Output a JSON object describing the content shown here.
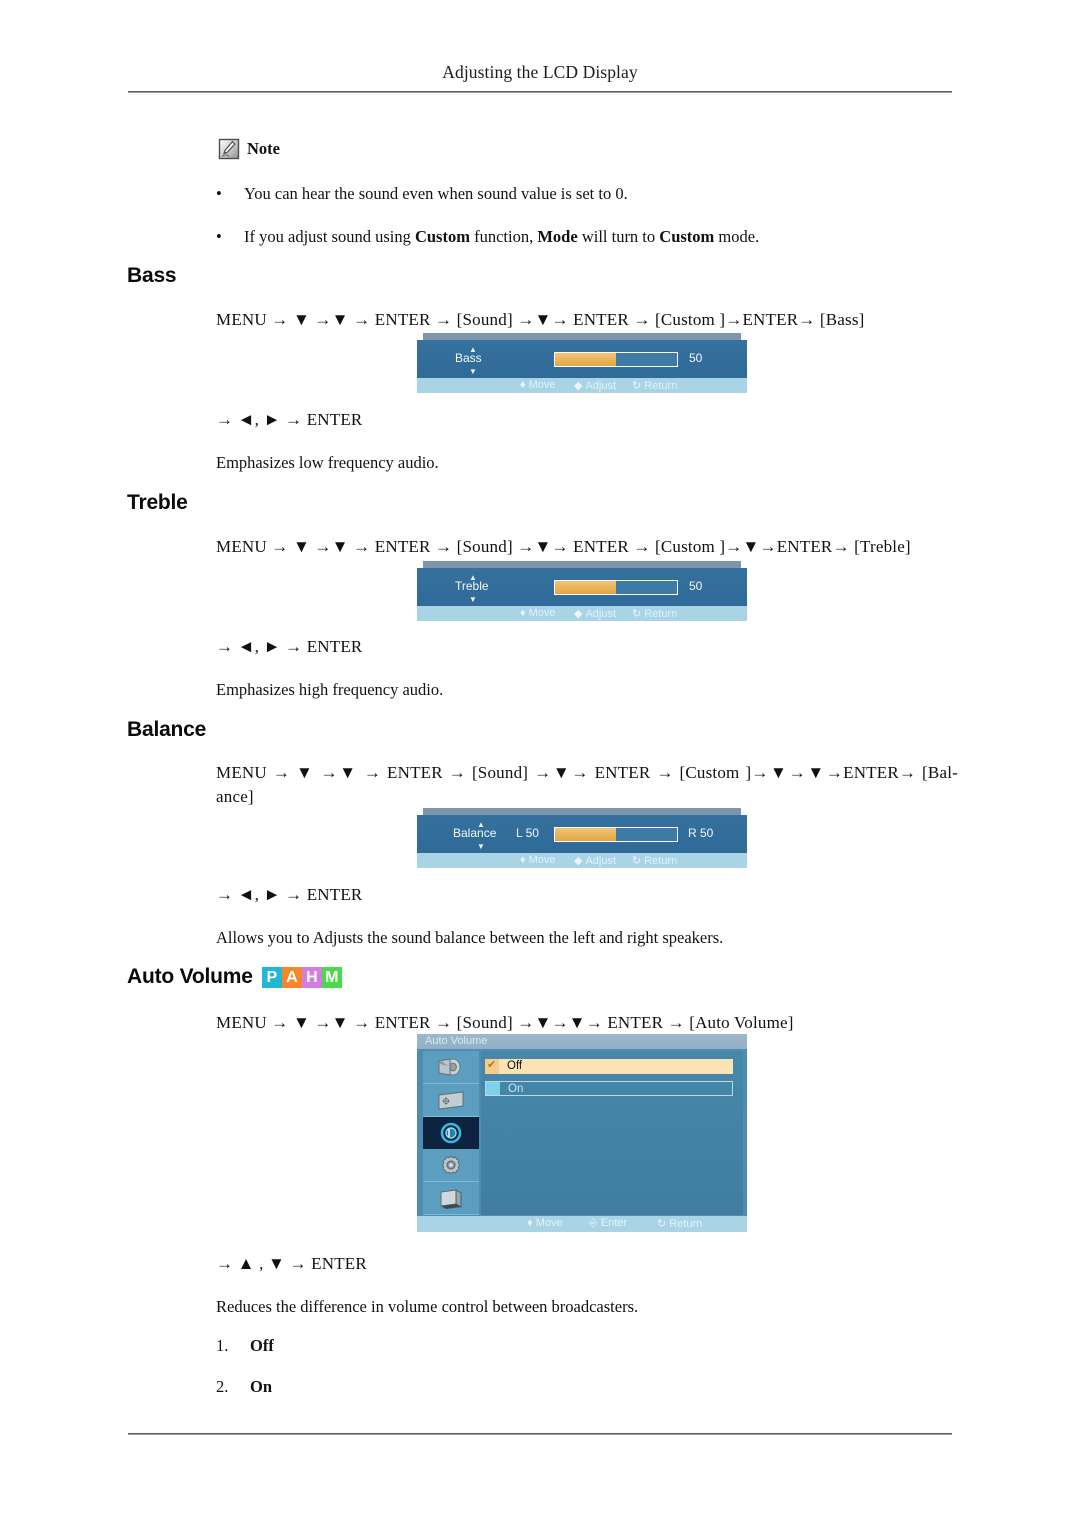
{
  "header": {
    "running_title": "Adjusting the LCD Display"
  },
  "note": {
    "icon": "note-pencil-icon",
    "label": "Note",
    "bullets": [
      {
        "parts": [
          {
            "text": "You can hear the sound even when sound value is set to 0.",
            "bold": false
          }
        ]
      },
      {
        "parts": [
          {
            "text": "If you adjust sound using ",
            "bold": false
          },
          {
            "text": "Custom",
            "bold": true
          },
          {
            "text": " function, ",
            "bold": false
          },
          {
            "text": "Mode",
            "bold": true
          },
          {
            "text": " will turn to ",
            "bold": false
          },
          {
            "text": "Custom",
            "bold": true
          },
          {
            "text": " mode.",
            "bold": false
          }
        ]
      }
    ]
  },
  "sections": [
    {
      "id": "bass",
      "heading": "Bass",
      "badges": [],
      "menu_path": "MENU → ▼ →▼ → ENTER → [Sound] →▼→ ENTER → [Custom ]→ENTER→ [Bass]",
      "key_path": "→ ◄, ► → ENTER",
      "description": "Emphasizes low frequency audio.",
      "osd": {
        "type": "slider",
        "label": "Bass",
        "value": "50",
        "fill_percent": 50,
        "footer": [
          {
            "glyph": "⬍",
            "label": "Move"
          },
          {
            "glyph": "⬌",
            "label": "Adjust"
          },
          {
            "glyph": "↺",
            "label": "Return"
          }
        ]
      }
    },
    {
      "id": "treble",
      "heading": "Treble",
      "badges": [],
      "menu_path": "MENU → ▼ →▼ → ENTER → [Sound] →▼→ ENTER → [Custom ]→▼→ENTER→ [Treble]",
      "key_path": "→ ◄, ► → ENTER",
      "description": "Emphasizes high frequency audio.",
      "osd": {
        "type": "slider",
        "label": "Treble",
        "value": "50",
        "fill_percent": 50,
        "footer": [
          {
            "glyph": "⬍",
            "label": "Move"
          },
          {
            "glyph": "⬌",
            "label": "Adjust"
          },
          {
            "glyph": "↺",
            "label": "Return"
          }
        ]
      }
    },
    {
      "id": "balance",
      "heading": "Balance",
      "badges": [],
      "menu_path": "MENU → ▼ →▼ → ENTER → [Sound] →▼→ ENTER → [Custom ]→▼→▼→ENTER→ [Bal-ance]",
      "key_path": "→ ◄, ► → ENTER",
      "description": "Allows you to Adjusts the sound balance between the left and right speakers.",
      "osd": {
        "type": "slider",
        "label": "Balance",
        "left_label": "L  50",
        "right_label": "R  50",
        "fill_percent": 50,
        "footer": [
          {
            "glyph": "⬍",
            "label": "Move"
          },
          {
            "glyph": "⬌",
            "label": "Adjust"
          },
          {
            "glyph": "↺",
            "label": "Return"
          }
        ]
      }
    },
    {
      "id": "auto-volume",
      "heading": "Auto Volume",
      "badges": [
        {
          "letter": "P",
          "color": "#23b7d6"
        },
        {
          "letter": "A",
          "color": "#f5862a"
        },
        {
          "letter": "H",
          "color": "#d47de0"
        },
        {
          "letter": "M",
          "color": "#49d94a"
        }
      ],
      "menu_path": "MENU → ▼ →▼ → ENTER → [Sound] →▼→▼→ ENTER → [Auto Volume]",
      "key_path": "→ ▲ , ▼ → ENTER",
      "description": "Reduces the difference in volume control between broadcasters.",
      "options": [
        {
          "num": "1.",
          "value": "Off"
        },
        {
          "num": "2.",
          "value": "On"
        }
      ],
      "osd": {
        "type": "menu",
        "title": "Auto Volume",
        "sidebar_icons": [
          "picture-icon",
          "display-icon",
          "sound-icon",
          "setup-icon",
          "multi-control-icon"
        ],
        "sidebar_selected_index": 2,
        "items": [
          {
            "label": "Off",
            "selected": true,
            "check": "✔"
          },
          {
            "label": "On",
            "selected": false,
            "check": ""
          }
        ],
        "footer": [
          {
            "glyph": "⬍",
            "label": "Move"
          },
          {
            "glyph": "⏎",
            "label": "Enter"
          },
          {
            "glyph": "↺",
            "label": "Return"
          }
        ]
      }
    }
  ],
  "colors": {
    "osd_body": "#2f6a98",
    "osd_fill": "#e9b45c",
    "osd_footer": "#a9d4e6",
    "osd_selected_row": "#fce3b4",
    "osd_sidebar": "#5b9ec0",
    "osd_sidebar_selected": "#0d2340"
  }
}
